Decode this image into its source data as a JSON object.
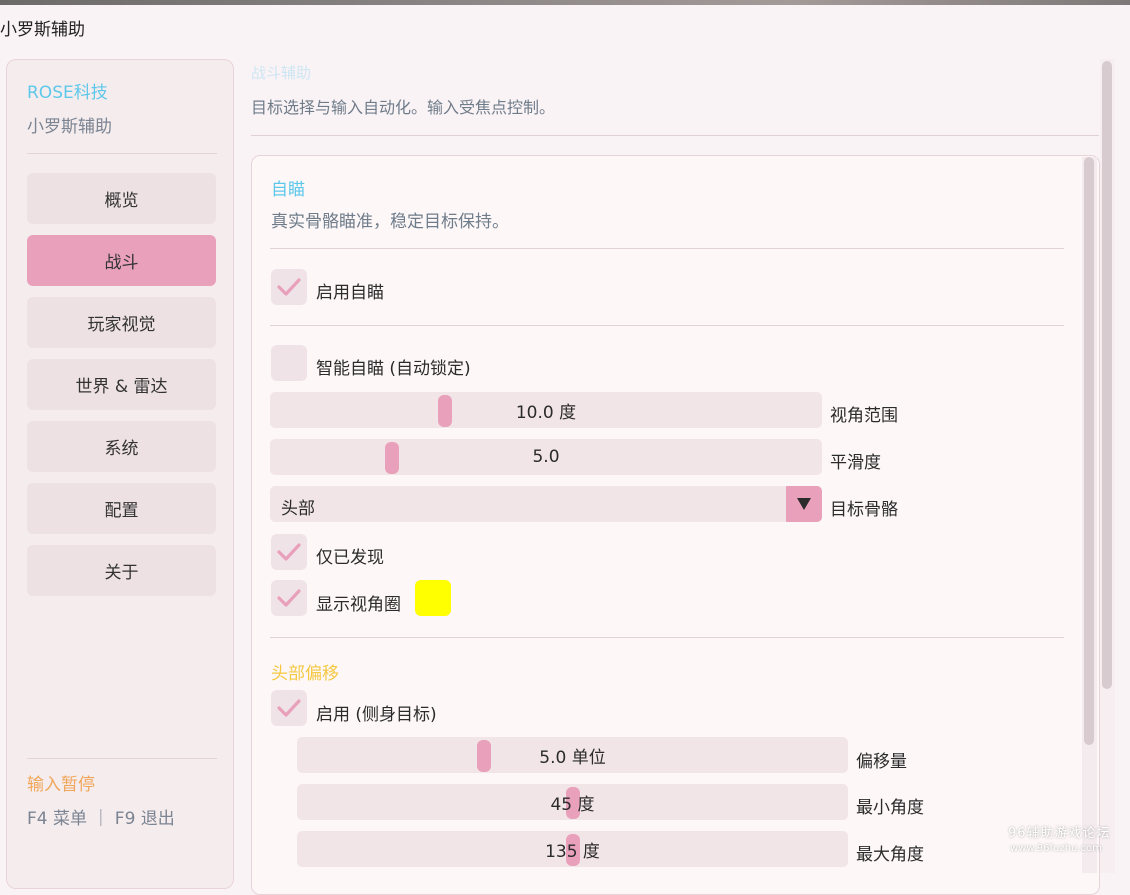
{
  "window": {
    "title": "小罗斯辅助"
  },
  "sidebar": {
    "brand": "ROSE科技",
    "subtitle": "小罗斯辅助",
    "nav": [
      {
        "label": "概览"
      },
      {
        "label": "战斗",
        "active": true
      },
      {
        "label": "玩家视觉"
      },
      {
        "label": "世界 & 雷达"
      },
      {
        "label": "系统"
      },
      {
        "label": "配置"
      },
      {
        "label": "关于"
      }
    ],
    "status": "输入暂停",
    "hotkeys": "F4 菜单 ｜ F9 退出"
  },
  "page": {
    "title": "战斗辅助",
    "subtitle": "目标选择与输入自动化。输入受焦点控制。"
  },
  "aimbot": {
    "title": "自瞄",
    "description": "真实骨骼瞄准，稳定目标保持。",
    "enable": {
      "label": "启用自瞄",
      "checked": true
    },
    "smart": {
      "label": "智能自瞄 (自动锁定)",
      "checked": false
    },
    "fov": {
      "value_text": "10.0 度",
      "label": "视角范围",
      "fraction": 0.32
    },
    "smooth": {
      "value_text": "5.0",
      "label": "平滑度",
      "fraction": 0.22
    },
    "bone": {
      "value": "头部",
      "label": "目标骨骼"
    },
    "visible_only": {
      "label": "仅已发现",
      "checked": true
    },
    "show_fov": {
      "label": "显示视角圈",
      "checked": true,
      "color": "#ffff00"
    }
  },
  "head_offset": {
    "title": "头部偏移",
    "title_color": "#f5c842",
    "enable": {
      "label": "启用 (侧身目标)",
      "checked": true
    },
    "amount": {
      "value_text": "5.0 单位",
      "label": "偏移量",
      "fraction": 0.34
    },
    "min_angle": {
      "value_text": "45 度",
      "label": "最小角度",
      "fraction": 0.5
    },
    "max_angle": {
      "value_text": "135 度",
      "label": "最大角度",
      "fraction": 0.5
    }
  },
  "theme": {
    "accent": "#e8a0bb",
    "title_blue": "#5ec8ea",
    "warning": "#f0a65a"
  },
  "watermark": {
    "line1": "96辅助游戏论坛",
    "line2": "www.96fuzhu.com"
  }
}
